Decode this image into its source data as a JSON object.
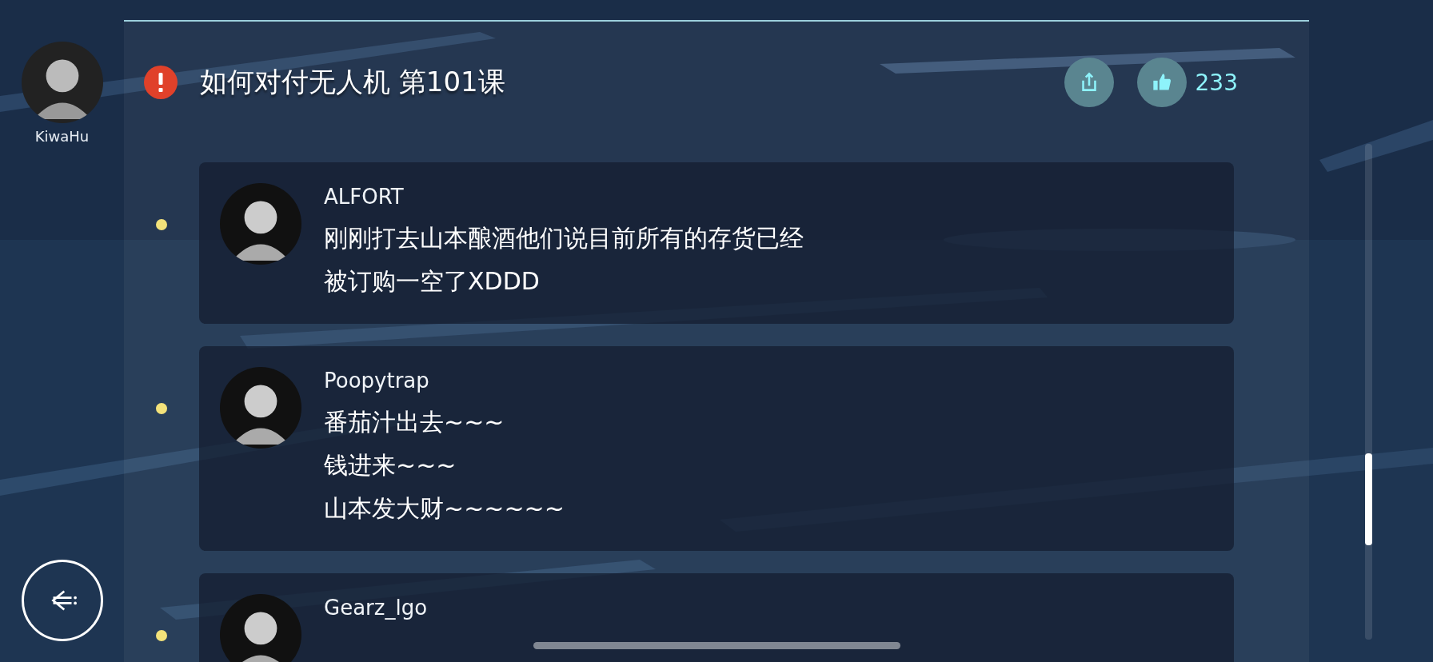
{
  "user": {
    "name": "KiwaHu"
  },
  "post": {
    "title": "如何对付无人机 第101课",
    "likes": "233"
  },
  "comments": [
    {
      "author": "ALFORT",
      "lines": [
        "刚刚打去山本酿酒他们说目前所有的存货已经",
        "被订购一空了XDDD"
      ]
    },
    {
      "author": "Poopytrap",
      "lines": [
        "番茄汁出去~~~",
        "钱进来~~~",
        "山本发大财~~~~~~"
      ]
    },
    {
      "author": "Gearz_lgo"
    }
  ]
}
